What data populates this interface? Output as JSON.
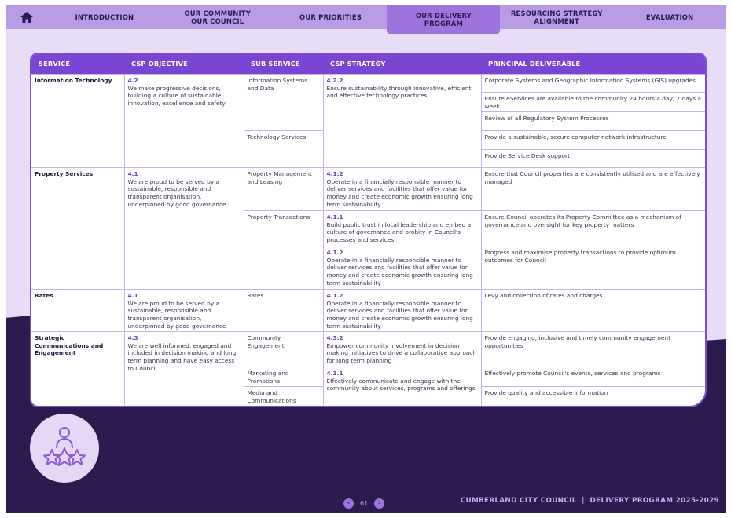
{
  "nav": {
    "items": [
      {
        "label": "INTRODUCTION",
        "active": false
      },
      {
        "label": "OUR COMMUNITY\nOUR COUNCIL",
        "active": false
      },
      {
        "label": "OUR PRIORITIES",
        "active": false
      },
      {
        "label": "OUR DELIVERY\nPROGRAM",
        "active": true
      },
      {
        "label": "RESOURCING STRATEGY\nALIGNMENT",
        "active": false
      },
      {
        "label": "EVALUATION",
        "active": false
      }
    ]
  },
  "table": {
    "headers": [
      "SERVICE",
      "CSP OBJECTIVE",
      "SUB SERVICE",
      "CSP STRATEGY",
      "PRINCIPAL DELIVERABLE"
    ],
    "services": [
      {
        "service": "Information Technology",
        "objective_code": "4.2",
        "objective_text": "We make progressive decisions, building a culture of sustainable innovation, excellence and safety",
        "subservices": [
          {
            "name": "Information Systems and Data",
            "strategies": [
              {
                "code": "4.2.2",
                "text": "Ensure sustainability through innovative, efficient and effective technology practices",
                "rowspan": 5,
                "deliverables": [
                  "Corporate Systems and Geographic Information Systems (GIS) upgrades",
                  "Ensure eServices are available to the community 24 hours a day, 7 days a week",
                  "Review of all Regulatory System Processes"
                ]
              }
            ]
          },
          {
            "name": "Technology Services",
            "strategies": [
              {
                "code": "",
                "text": "",
                "rowspan": 0,
                "deliverables": [
                  "Provide a sustainable, secure computer network infrastructure",
                  "Provide Service Desk support"
                ]
              }
            ]
          }
        ]
      },
      {
        "service": "Property Services",
        "objective_code": "4.1",
        "objective_text": "We are proud to be served by a sustainable, responsible and transparent organisation, underpinned by good governance",
        "subservices": [
          {
            "name": "Property Management and Leasing",
            "strategies": [
              {
                "code": "4.1.2",
                "text": "Operate in a financially responsible manner to deliver services and facilities that offer value for money and create economic growth ensuring long term sustainability",
                "rowspan": 1,
                "deliverables": [
                  "Ensure that Council properties are consistently utilised and are effectively managed"
                ]
              }
            ]
          },
          {
            "name": "Property Transactions",
            "strategies": [
              {
                "code": "4.1.1",
                "text": "Build public trust in local leadership and embed a culture of governance and probity in Council's processes and services",
                "rowspan": 1,
                "deliverables": [
                  "Ensure Council operates its Property Committee as a mechanism of governance and oversight for key property matters"
                ]
              },
              {
                "code": "4.1.2",
                "text": "Operate in a financially responsible manner to deliver services and facilities that offer value for money and create economic growth ensuring long term sustainability",
                "rowspan": 1,
                "deliverables": [
                  "Progress and maximise property transactions to provide optimum outcomes for Council"
                ]
              }
            ]
          }
        ]
      },
      {
        "service": "Rates",
        "objective_code": "4.1",
        "objective_text": "We are proud to be served by a sustainable, responsible and transparent organisation, underpinned by good governance",
        "subservices": [
          {
            "name": "Rates",
            "strategies": [
              {
                "code": "4.1.2",
                "text": "Operate in a financially responsible manner to deliver services and facilities that offer value for money and create economic growth ensuring long term sustainability",
                "rowspan": 1,
                "deliverables": [
                  "Levy and collection of rates and charges"
                ]
              }
            ]
          }
        ]
      },
      {
        "service": "Strategic Communications and Engagement",
        "objective_code": "4.3",
        "objective_text": "We are well informed, engaged and included in decision making and long term planning and have easy access to Council",
        "subservices": [
          {
            "name": "Community Engagement",
            "strategies": [
              {
                "code": "4.3.2",
                "text": "Empower community involvement in decision making initiatives to drive a collaborative approach for long term planning",
                "rowspan": 1,
                "deliverables": [
                  "Provide engaging, inclusive and timely community engagement opportunities"
                ]
              }
            ]
          },
          {
            "name": "Marketing and Promotions",
            "strategies": [
              {
                "code": "4.3.1",
                "text": "Effectively communicate and engage with the community about services, programs and offerings",
                "rowspan": 2,
                "deliverables": [
                  "Effectively promote Council's events, services and programs"
                ]
              }
            ]
          },
          {
            "name": "Media and Communications",
            "strategies": [
              {
                "code": "",
                "text": "",
                "rowspan": 0,
                "deliverables": [
                  "Provide quality and accessible information"
                ]
              }
            ]
          }
        ]
      }
    ]
  },
  "pager": {
    "page": "61",
    "prev": "‹",
    "next": "›"
  },
  "footer": "CUMBERLAND CITY COUNCIL  |  DELIVERY PROGRAM 2025-2029",
  "colors": {
    "accent": "#7b45d3",
    "nav": "#b99be6",
    "dark": "#2b1b4f",
    "light": "#e8ddf6"
  },
  "icons": {
    "home": "home-icon",
    "badge": "person-stars-icon"
  }
}
